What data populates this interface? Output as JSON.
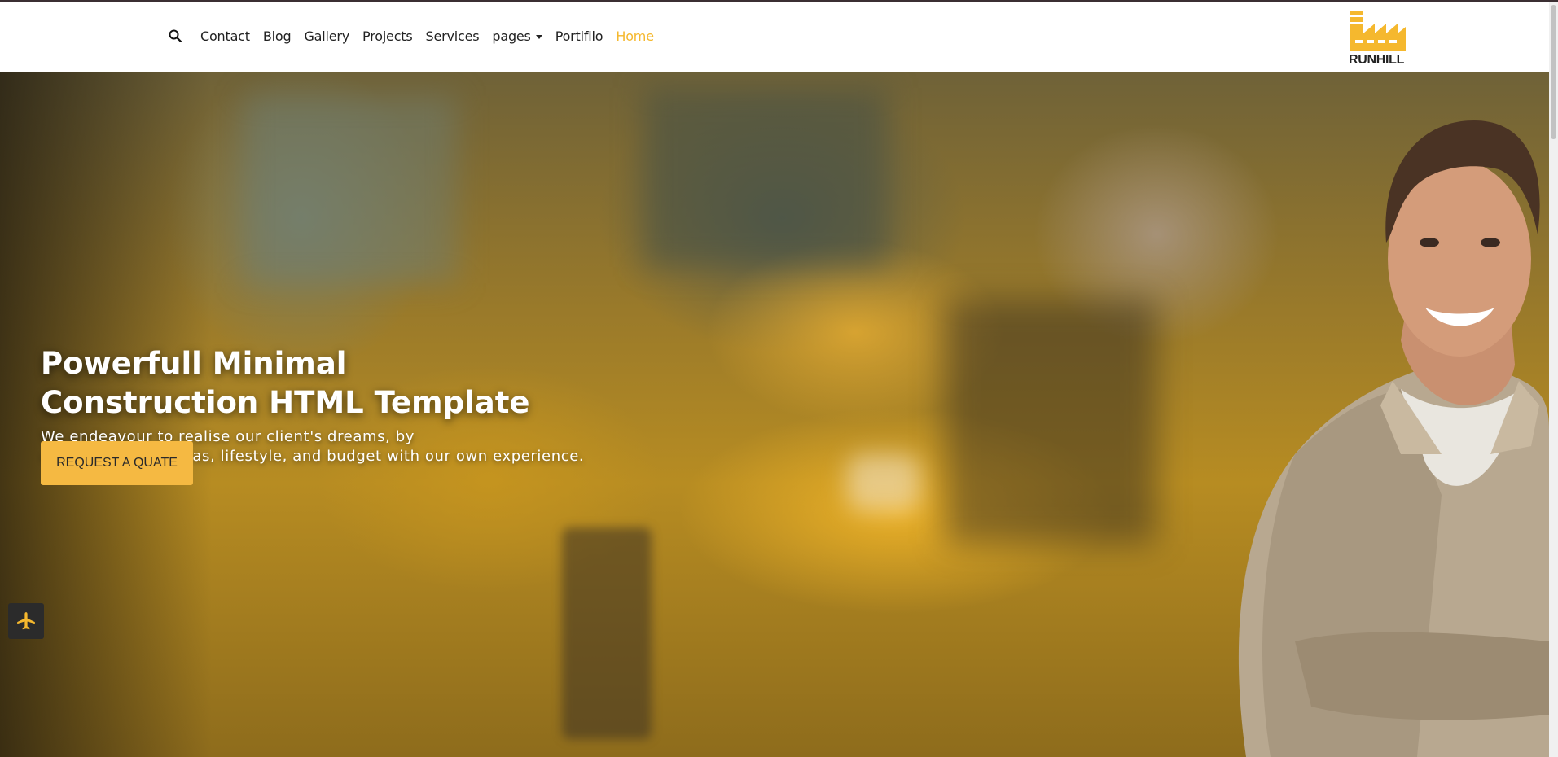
{
  "nav": {
    "search_icon": "search-icon",
    "links": [
      "Contact",
      "Blog",
      "Gallery",
      "Projects",
      "Services",
      "pages",
      "Portifilo",
      "Home"
    ],
    "active": "Home",
    "accent_color": "#f5b82e"
  },
  "logo": {
    "text": "RUNHILL",
    "icon": "factory-icon",
    "color": "#f5b82e"
  },
  "hero": {
    "title_line1": "Powerfull Minimal",
    "title_line2": "Construction HTML Template",
    "subtitle_line1": "We endeavour to realise our client's dreams, by",
    "subtitle_line2": "combining their ideas, lifestyle, and budget with our own experience.",
    "cta_label": "REQUEST A QUATE",
    "cta_color": "#f5b942"
  },
  "floating_button": {
    "icon": "airplane-icon"
  }
}
